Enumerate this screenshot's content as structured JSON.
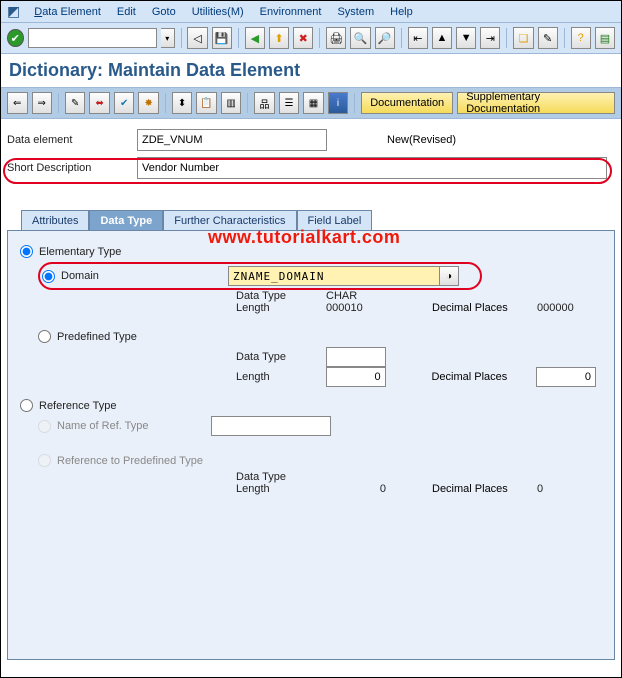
{
  "menu": {
    "data_element": "Data Element",
    "edit": "Edit",
    "goto": "Goto",
    "utilities": "Utilities(M)",
    "environment": "Environment",
    "system": "System",
    "help": "Help"
  },
  "title": "Dictionary: Maintain Data Element",
  "doc_btn": "Documentation",
  "supp_doc_btn": "Supplementary Documentation",
  "header": {
    "de_label": "Data element",
    "de_value": "ZDE_VNUM",
    "status": "New(Revised)",
    "sd_label": "Short Description",
    "sd_value": "Vendor Number"
  },
  "tabs": {
    "attributes": "Attributes",
    "data_type": "Data Type",
    "further": "Further Characteristics",
    "field_label": "Field Label"
  },
  "watermark": "www.tutorialkart.com",
  "panel": {
    "elementary": "Elementary Type",
    "domain": "Domain",
    "domain_value": "ZNAME_DOMAIN",
    "data_type_lbl": "Data Type",
    "data_type_val": "CHAR",
    "length_lbl": "Length",
    "length_val": "000010",
    "dec_lbl": "Decimal Places",
    "dec_val": "000000",
    "predefined": "Predefined Type",
    "pre_len": "0",
    "pre_dec": "0",
    "reference": "Reference Type",
    "name_ref": "Name of Ref. Type",
    "ref_predef": "Reference to Predefined Type",
    "ref_len": "0",
    "ref_dec": "0"
  }
}
